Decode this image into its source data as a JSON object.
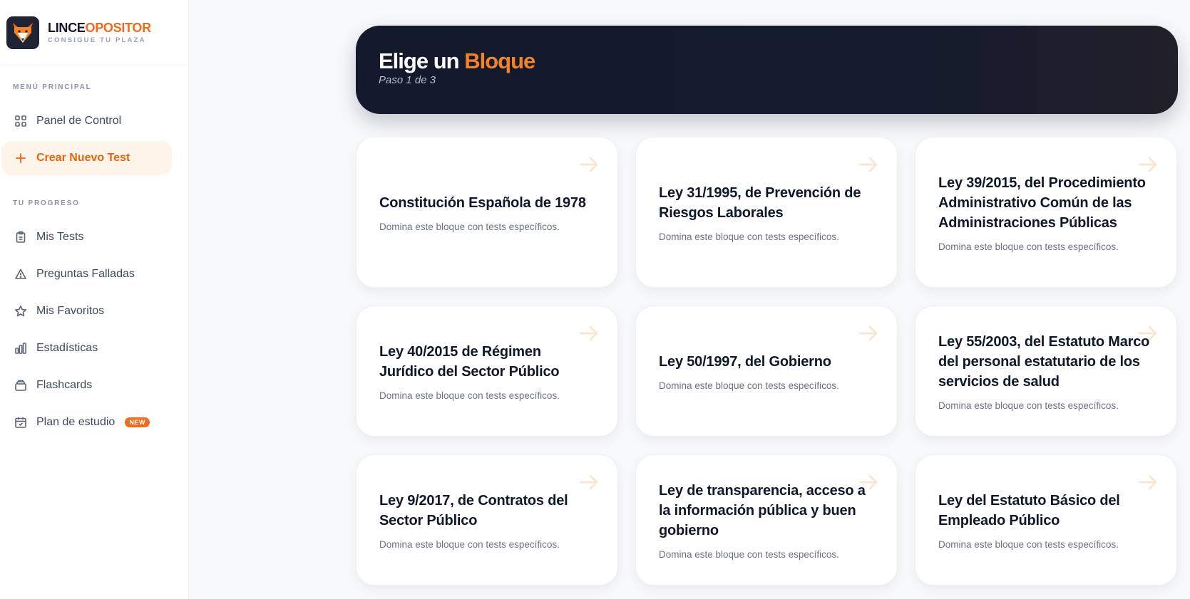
{
  "brand": {
    "name_part1": "LINCE",
    "name_part2": "OPOSITOR",
    "tagline": "CONSIGUE TU PLAZA"
  },
  "sidebar": {
    "section_main": "MENÚ PRINCIPAL",
    "section_progress": "TU PROGRESO",
    "items": [
      {
        "label": "Panel de Control",
        "icon": "grid-icon"
      },
      {
        "label": "Crear Nuevo Test",
        "icon": "plus-icon",
        "active": true
      },
      {
        "label": "Mis Tests",
        "icon": "clipboard-icon"
      },
      {
        "label": "Preguntas Falladas",
        "icon": "warning-icon"
      },
      {
        "label": "Mis Favoritos",
        "icon": "star-icon"
      },
      {
        "label": "Estadísticas",
        "icon": "bar-chart-icon"
      },
      {
        "label": "Flashcards",
        "icon": "cards-icon"
      },
      {
        "label": "Plan de estudio",
        "icon": "calendar-icon",
        "badge": "NEW"
      }
    ]
  },
  "header": {
    "title_part1": "Elige un",
    "title_part2": "Bloque",
    "subtitle": "Paso 1 de 3"
  },
  "cards": [
    {
      "title": "Constitución Española de 1978",
      "desc": "Domina este bloque con tests específicos."
    },
    {
      "title": "Ley 31/1995, de Prevención de Riesgos Laborales",
      "desc": "Domina este bloque con tests específicos."
    },
    {
      "title": "Ley 39/2015, del Procedimiento Administrativo Común de las Administraciones Públicas",
      "desc": "Domina este bloque con tests específicos."
    },
    {
      "title": "Ley 40/2015 de Régimen Jurídico del Sector Público",
      "desc": "Domina este bloque con tests específicos."
    },
    {
      "title": "Ley 50/1997, del Gobierno",
      "desc": "Domina este bloque con tests específicos."
    },
    {
      "title": "Ley 55/2003, del Estatuto Marco del personal estatutario de los servicios de salud",
      "desc": "Domina este bloque con tests específicos."
    },
    {
      "title": "Ley 9/2017, de Contratos del Sector Público",
      "desc": "Domina este bloque con tests específicos."
    },
    {
      "title": "Ley de transparencia, acceso a la información pública y buen gobierno",
      "desc": "Domina este bloque con tests específicos."
    },
    {
      "title": "Ley del Estatuto Básico del Empleado Público",
      "desc": "Domina este bloque con tests específicos."
    }
  ],
  "colors": {
    "accent": "#f26b1d",
    "active_bg": "#fff4ea",
    "header_bg": "#131a2c"
  }
}
